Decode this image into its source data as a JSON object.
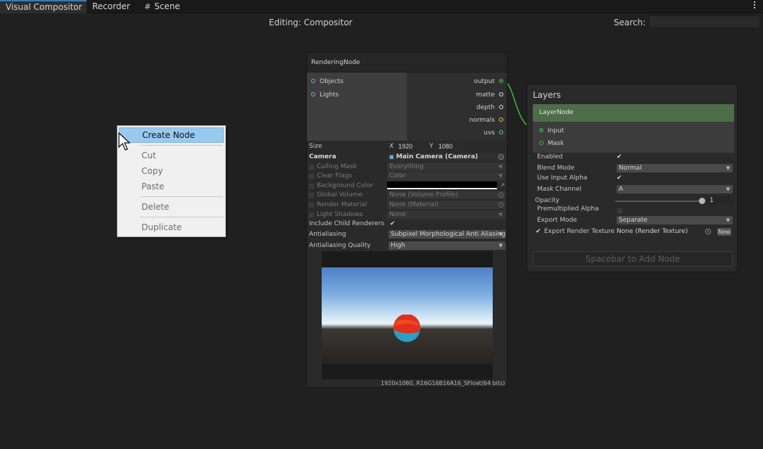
{
  "tabs": [
    {
      "label": "Visual Compositor",
      "active": true
    },
    {
      "label": "Recorder",
      "active": false
    },
    {
      "label": "Scene",
      "active": false,
      "icon": "grid-hash-icon"
    }
  ],
  "header": {
    "editing": "Editing: Compositor",
    "search_label": "Search:",
    "search_value": ""
  },
  "context_menu": {
    "items": [
      {
        "label": "Create Node",
        "highlighted": true
      },
      {
        "label": "Cut"
      },
      {
        "label": "Copy"
      },
      {
        "label": "Paste"
      },
      {
        "label": "Delete"
      },
      {
        "label": "Duplicate"
      }
    ]
  },
  "rendering_node": {
    "title": "RenderingNode",
    "inputs": [
      {
        "label": "Objects",
        "color": "#7ea6d6"
      },
      {
        "label": "Lights",
        "color": "#7ea6d6"
      }
    ],
    "outputs": [
      {
        "label": "output",
        "color": "#3cbf3c"
      },
      {
        "label": "matte",
        "color": "#e6e6e6"
      },
      {
        "label": "depth",
        "color": "#e6e6e6"
      },
      {
        "label": "normals",
        "color": "#e8c84a"
      },
      {
        "label": "uvs",
        "color": "#58c8e8"
      }
    ],
    "size": {
      "label": "Size",
      "x_label": "X",
      "x": "1920",
      "y_label": "Y",
      "y": "1080"
    },
    "camera": {
      "label": "Camera",
      "value": "Main Camera (Camera)"
    },
    "props": [
      {
        "label": "Culling Mask",
        "value": "Everything"
      },
      {
        "label": "Clear Flags",
        "value": "Color"
      },
      {
        "label": "Background Color",
        "value": ""
      },
      {
        "label": "Global Volume",
        "value": "None (Volume Profile)"
      },
      {
        "label": "Render Material",
        "value": "None (Material)"
      },
      {
        "label": "Light Shadows",
        "value": "None"
      }
    ],
    "include_child_label": "Include Child Renderers",
    "include_child_checked": true,
    "antialiasing": {
      "label": "Antialiasing",
      "value": "Subpixel Morphological Anti Aliasing"
    },
    "antialiasing_quality": {
      "label": "Antialiasing Quality",
      "value": "High"
    },
    "preview_info": "1920x1080, R16G16B16A16_SFloat(64 bits)"
  },
  "layers_node": {
    "title": "Layers",
    "layer_title": "LayerNode",
    "ports": [
      {
        "label": "Input",
        "color": "#3cbf3c"
      },
      {
        "label": "Mask",
        "color": "#3cbf3c"
      }
    ],
    "enabled": {
      "label": "Enabled",
      "checked": true
    },
    "blend_mode": {
      "label": "Blend Mode",
      "value": "Normal"
    },
    "use_input_alpha": {
      "label": "Use Input Alpha",
      "checked": true
    },
    "mask_channel": {
      "label": "Mask Channel",
      "value": "A"
    },
    "opacity": {
      "label": "Opacity",
      "value": "1",
      "fraction": 1.0
    },
    "premultiplied": {
      "label": "Premultiplied Alpha",
      "checked": false
    },
    "export_mode": {
      "label": "Export Mode",
      "value": "Separate"
    },
    "export_rt": {
      "label": "Export Render Texture",
      "checked": true,
      "value": "None (Render Texture)",
      "button": "New"
    },
    "add_hint": "Spacebar to Add Node"
  }
}
